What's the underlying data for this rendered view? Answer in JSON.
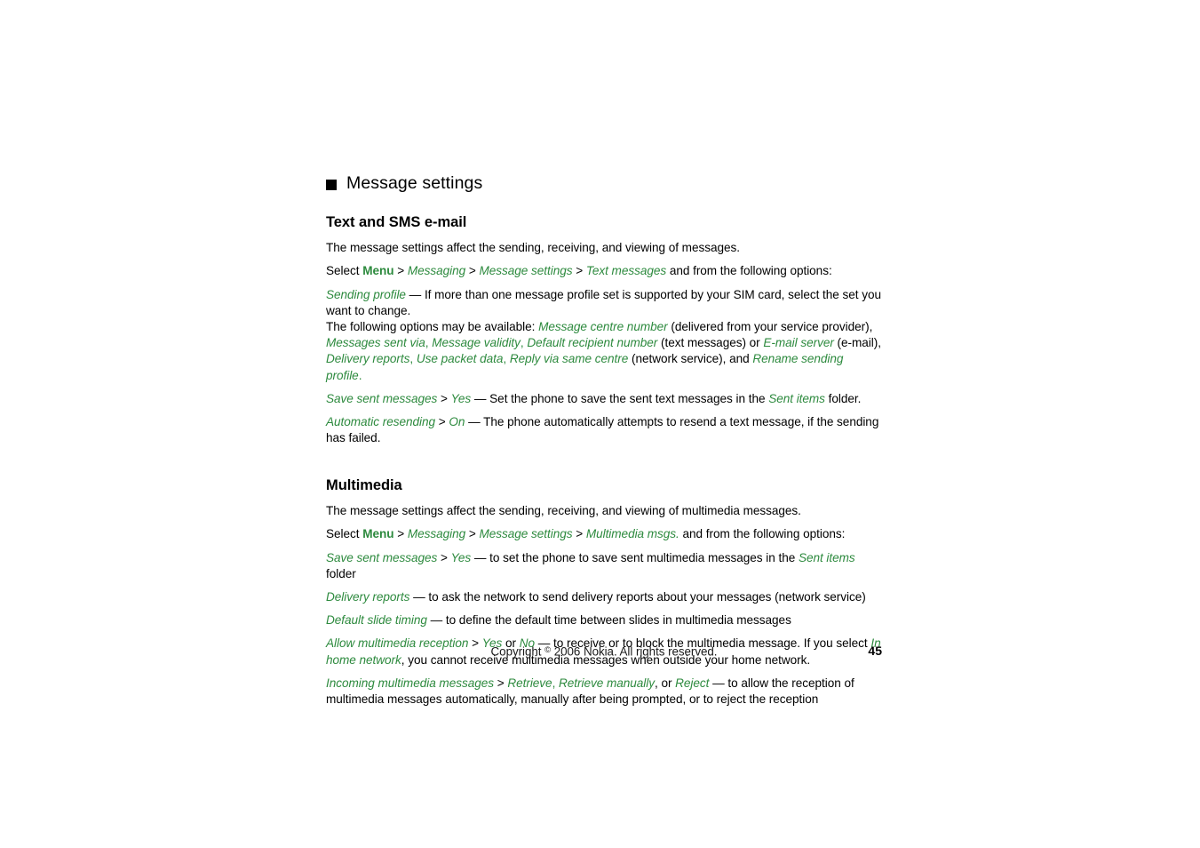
{
  "document": {
    "chapter": {
      "bullet": "black-square-bullet",
      "title": "Message settings"
    },
    "sections": [
      {
        "heading": "Text and SMS e-mail",
        "paragraphs": [
          {
            "id": "sms-intro",
            "runs": [
              {
                "style": "plain",
                "text": "The message settings affect the sending, receiving, and viewing of messages."
              }
            ]
          },
          {
            "id": "sms-path",
            "runs": [
              {
                "style": "plain",
                "text": "Select "
              },
              {
                "style": "ui-bold",
                "text": "Menu"
              },
              {
                "style": "sep",
                "text": " > "
              },
              {
                "style": "ui",
                "text": "Messaging"
              },
              {
                "style": "sep",
                "text": " > "
              },
              {
                "style": "ui",
                "text": "Message settings"
              },
              {
                "style": "sep",
                "text": " > "
              },
              {
                "style": "ui",
                "text": "Text messages"
              },
              {
                "style": "plain",
                "text": " and from the following options:"
              }
            ]
          },
          {
            "id": "sending-profile",
            "runs": [
              {
                "style": "ui",
                "text": "Sending profile"
              },
              {
                "style": "plain",
                "text": " — If more than one message profile set is supported by your SIM card, select the set you want to change."
              }
            ]
          },
          {
            "id": "available-options",
            "runs": [
              {
                "style": "plain",
                "text": "The following options may be available: "
              },
              {
                "style": "ui",
                "text": "Message centre number"
              },
              {
                "style": "plain",
                "text": " (delivered from your service provider), "
              },
              {
                "style": "ui",
                "text": "Messages sent via"
              },
              {
                "style": "pun-green",
                "text": ", "
              },
              {
                "style": "ui",
                "text": "Message validity"
              },
              {
                "style": "pun-green",
                "text": ", "
              },
              {
                "style": "ui",
                "text": "Default recipient number"
              },
              {
                "style": "plain",
                "text": " (text messages) or "
              },
              {
                "style": "ui",
                "text": "E-mail server"
              },
              {
                "style": "plain",
                "text": " (e-mail), "
              },
              {
                "style": "ui",
                "text": "Delivery reports"
              },
              {
                "style": "pun-green",
                "text": ", "
              },
              {
                "style": "ui",
                "text": "Use packet data"
              },
              {
                "style": "pun-green",
                "text": ", "
              },
              {
                "style": "ui",
                "text": "Reply via same centre"
              },
              {
                "style": "plain",
                "text": " (network service), and "
              },
              {
                "style": "ui",
                "text": "Rename sending profile"
              },
              {
                "style": "pun-green",
                "text": "."
              }
            ]
          },
          {
            "id": "save-sent-messages-sms",
            "runs": [
              {
                "style": "ui",
                "text": "Save sent messages"
              },
              {
                "style": "sep",
                "text": " > "
              },
              {
                "style": "ui",
                "text": "Yes"
              },
              {
                "style": "plain",
                "text": " — Set the phone to save the sent text messages in the "
              },
              {
                "style": "ui",
                "text": "Sent items"
              },
              {
                "style": "plain",
                "text": " folder."
              }
            ]
          },
          {
            "id": "automatic-resending",
            "runs": [
              {
                "style": "ui",
                "text": "Automatic resending"
              },
              {
                "style": "sep",
                "text": " > "
              },
              {
                "style": "ui",
                "text": "On"
              },
              {
                "style": "plain",
                "text": " — The phone automatically attempts to resend a text message, if the sending has failed."
              }
            ]
          }
        ]
      },
      {
        "heading": "Multimedia",
        "paragraphs": [
          {
            "id": "mms-intro",
            "runs": [
              {
                "style": "plain",
                "text": "The message settings affect the sending, receiving, and viewing of multimedia messages."
              }
            ]
          },
          {
            "id": "mms-path",
            "runs": [
              {
                "style": "plain",
                "text": "Select "
              },
              {
                "style": "ui-bold",
                "text": "Menu"
              },
              {
                "style": "sep",
                "text": " > "
              },
              {
                "style": "ui",
                "text": "Messaging"
              },
              {
                "style": "sep",
                "text": " > "
              },
              {
                "style": "ui",
                "text": "Message settings"
              },
              {
                "style": "sep",
                "text": " > "
              },
              {
                "style": "ui",
                "text": "Multimedia msgs."
              },
              {
                "style": "plain",
                "text": " and from the following options:"
              }
            ]
          },
          {
            "id": "save-sent-messages-mms",
            "runs": [
              {
                "style": "ui",
                "text": "Save sent messages"
              },
              {
                "style": "sep",
                "text": " > "
              },
              {
                "style": "ui",
                "text": "Yes"
              },
              {
                "style": "plain",
                "text": " — to set the phone to save sent multimedia messages in the "
              },
              {
                "style": "ui",
                "text": "Sent items"
              },
              {
                "style": "plain",
                "text": " folder"
              }
            ]
          },
          {
            "id": "delivery-reports-mms",
            "runs": [
              {
                "style": "ui",
                "text": "Delivery reports"
              },
              {
                "style": "plain",
                "text": " — to ask the network to send delivery reports about your messages (network service)"
              }
            ]
          },
          {
            "id": "default-slide-timing",
            "runs": [
              {
                "style": "ui",
                "text": "Default slide timing"
              },
              {
                "style": "plain",
                "text": " — to define the default time between slides in multimedia messages"
              }
            ]
          },
          {
            "id": "allow-multimedia-reception",
            "runs": [
              {
                "style": "ui",
                "text": "Allow multimedia reception"
              },
              {
                "style": "sep",
                "text": " > "
              },
              {
                "style": "ui",
                "text": "Yes"
              },
              {
                "style": "plain",
                "text": " or "
              },
              {
                "style": "ui",
                "text": "No"
              },
              {
                "style": "plain",
                "text": " — to receive or to block the multimedia message. If you select "
              },
              {
                "style": "ui",
                "text": "In home network"
              },
              {
                "style": "plain",
                "text": ", you cannot receive multimedia messages when outside your home network."
              }
            ]
          },
          {
            "id": "incoming-multimedia-messages",
            "runs": [
              {
                "style": "ui",
                "text": "Incoming multimedia messages"
              },
              {
                "style": "sep",
                "text": " > "
              },
              {
                "style": "ui",
                "text": "Retrieve"
              },
              {
                "style": "pun-green",
                "text": ", "
              },
              {
                "style": "ui",
                "text": "Retrieve manually"
              },
              {
                "style": "plain",
                "text": ", or "
              },
              {
                "style": "ui",
                "text": "Reject"
              },
              {
                "style": "plain",
                "text": " — to allow the reception of multimedia messages automatically, manually after being prompted, or to reject the reception"
              }
            ]
          }
        ]
      }
    ],
    "footer": {
      "copyright_prefix": "Copyright ",
      "copyright_symbol": "©",
      "copyright_suffix": " 2006 Nokia. All rights reserved.",
      "page_number": "45"
    },
    "colors": {
      "ui_term_green": "#2d8a3e",
      "body_text": "#000000",
      "page_background": "#ffffff"
    }
  }
}
